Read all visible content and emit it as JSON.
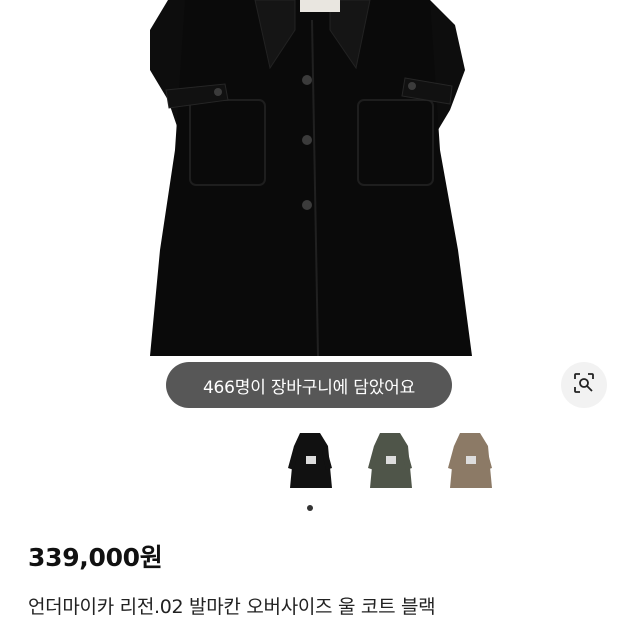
{
  "product": {
    "cart_count_text": "466명이 장바구니에 담았어요",
    "price": "339,000원",
    "title": "언더마이카 리전.02 발마칸 오버사이즈 울 코트 블랙"
  },
  "gallery": {
    "selected_index": 0,
    "thumbnails": [
      {
        "color_name": "black",
        "color": "#111111"
      },
      {
        "color_name": "khaki",
        "color": "#4f5549"
      },
      {
        "color_name": "beige",
        "color": "#8c7a66"
      }
    ]
  },
  "icons": {
    "lens": "image-search-icon"
  },
  "colors": {
    "pill_bg": "#282828",
    "dot_active": "#333333"
  }
}
